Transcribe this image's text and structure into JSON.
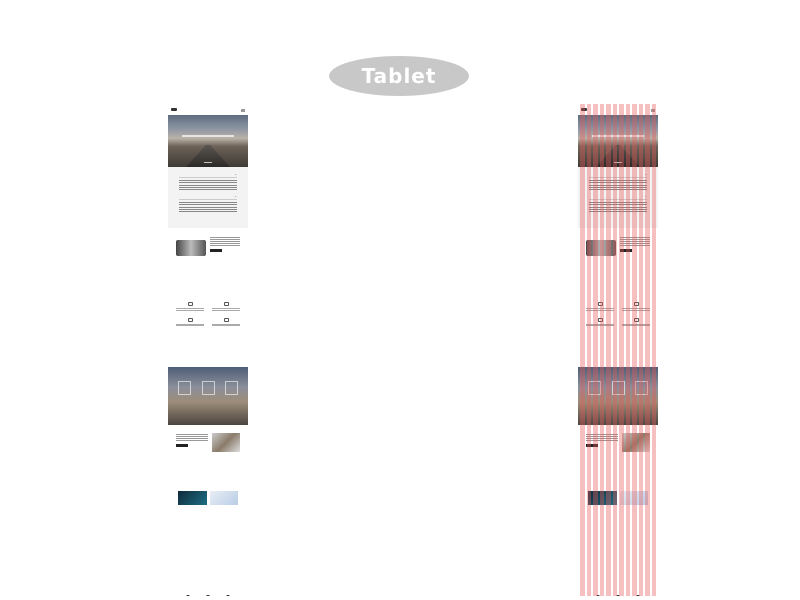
{
  "page": {
    "title": "Tablet"
  },
  "overlay": {
    "column_count": 12,
    "column_color": "#eb5a5a"
  }
}
